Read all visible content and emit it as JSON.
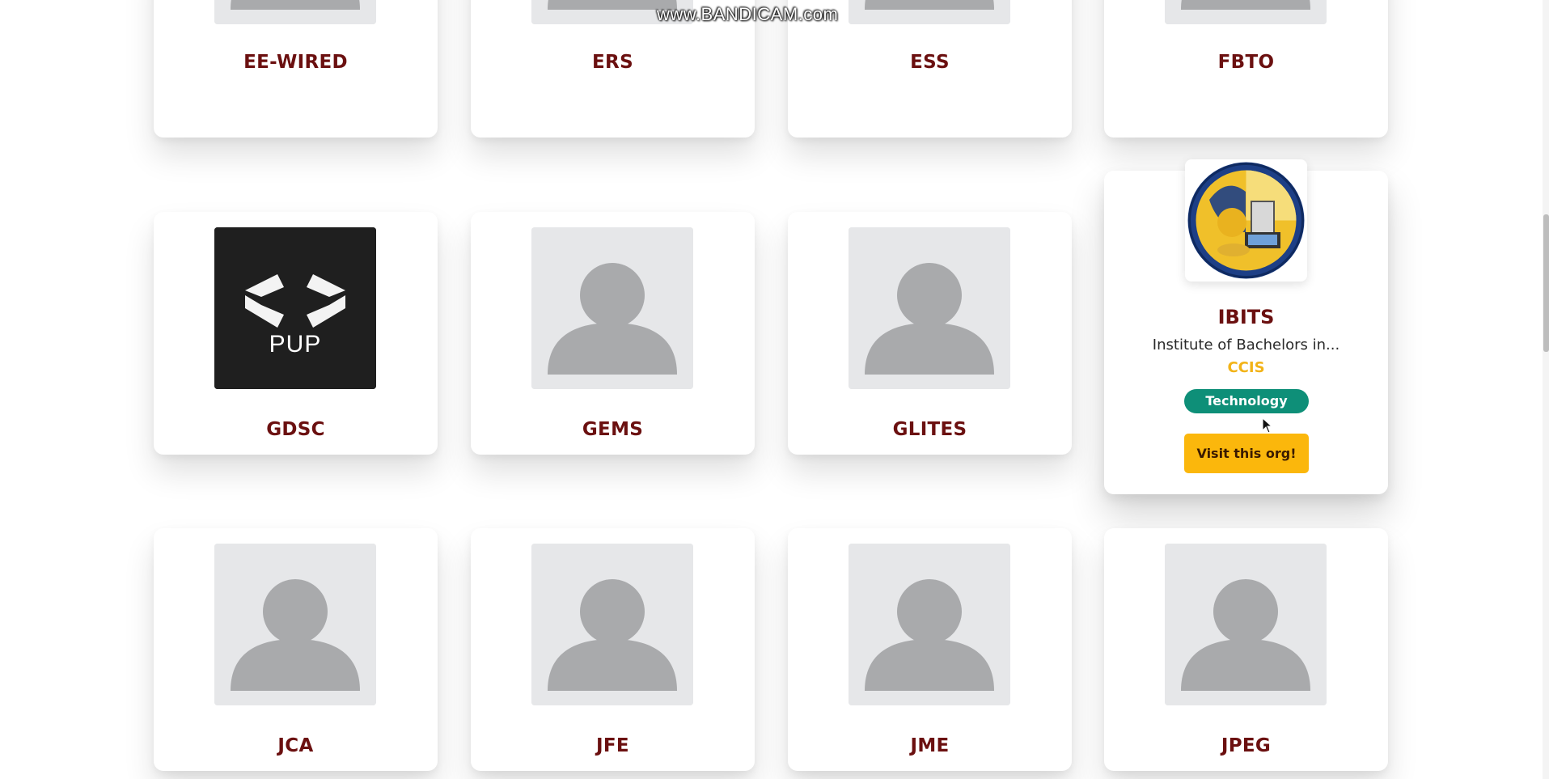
{
  "watermark": "www.BANDICAM.com",
  "rows": [
    {
      "cards": [
        {
          "name": "EE-WIRED",
          "logo": "default-avatar-icon"
        },
        {
          "name": "ERS",
          "logo": "default-avatar-icon"
        },
        {
          "name": "ESS",
          "logo": "default-avatar-icon"
        },
        {
          "name": "FBTO",
          "logo": "default-avatar-icon"
        }
      ]
    },
    {
      "cards": [
        {
          "name": "GDSC",
          "logo": "pup-code-logo",
          "logo_text": "PUP"
        },
        {
          "name": "GEMS",
          "logo": "default-avatar-icon"
        },
        {
          "name": "GLITES",
          "logo": "default-avatar-icon"
        }
      ]
    },
    {
      "cards": [
        {
          "name": "JCA",
          "logo": "default-avatar-icon"
        },
        {
          "name": "JFE",
          "logo": "default-avatar-icon"
        },
        {
          "name": "JME",
          "logo": "default-avatar-icon"
        },
        {
          "name": "JPEG",
          "logo": "default-avatar-icon"
        }
      ]
    }
  ],
  "featured": {
    "name": "IBITS",
    "description": "Institute of Bachelors in...",
    "college": "CCIS",
    "tag": "Technology",
    "button": "Visit this org!",
    "logo": "ibits-seal-logo"
  },
  "colors": {
    "title": "#6b1010",
    "college": "#f2b318",
    "tag_bg": "#0e8f78",
    "button_bg": "#fbb70c",
    "placeholder_bg": "#e6e7e9",
    "placeholder_fg": "#a9aaac"
  }
}
